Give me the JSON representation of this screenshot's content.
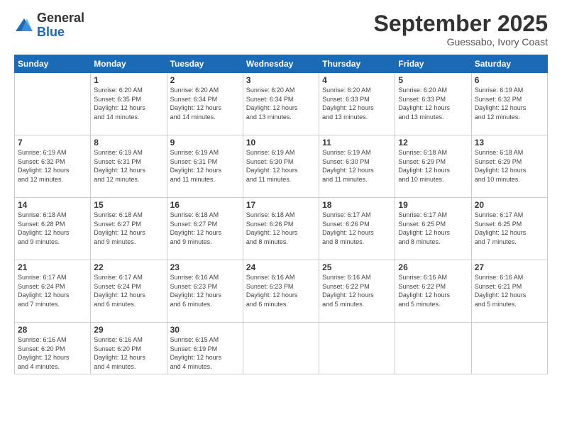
{
  "logo": {
    "general": "General",
    "blue": "Blue"
  },
  "header": {
    "month": "September 2025",
    "location": "Guessabo, Ivory Coast"
  },
  "weekdays": [
    "Sunday",
    "Monday",
    "Tuesday",
    "Wednesday",
    "Thursday",
    "Friday",
    "Saturday"
  ],
  "weeks": [
    [
      {
        "day": "",
        "info": ""
      },
      {
        "day": "1",
        "info": "Sunrise: 6:20 AM\nSunset: 6:35 PM\nDaylight: 12 hours\nand 14 minutes."
      },
      {
        "day": "2",
        "info": "Sunrise: 6:20 AM\nSunset: 6:34 PM\nDaylight: 12 hours\nand 14 minutes."
      },
      {
        "day": "3",
        "info": "Sunrise: 6:20 AM\nSunset: 6:34 PM\nDaylight: 12 hours\nand 13 minutes."
      },
      {
        "day": "4",
        "info": "Sunrise: 6:20 AM\nSunset: 6:33 PM\nDaylight: 12 hours\nand 13 minutes."
      },
      {
        "day": "5",
        "info": "Sunrise: 6:20 AM\nSunset: 6:33 PM\nDaylight: 12 hours\nand 13 minutes."
      },
      {
        "day": "6",
        "info": "Sunrise: 6:19 AM\nSunset: 6:32 PM\nDaylight: 12 hours\nand 12 minutes."
      }
    ],
    [
      {
        "day": "7",
        "info": "Sunrise: 6:19 AM\nSunset: 6:32 PM\nDaylight: 12 hours\nand 12 minutes."
      },
      {
        "day": "8",
        "info": "Sunrise: 6:19 AM\nSunset: 6:31 PM\nDaylight: 12 hours\nand 12 minutes."
      },
      {
        "day": "9",
        "info": "Sunrise: 6:19 AM\nSunset: 6:31 PM\nDaylight: 12 hours\nand 11 minutes."
      },
      {
        "day": "10",
        "info": "Sunrise: 6:19 AM\nSunset: 6:30 PM\nDaylight: 12 hours\nand 11 minutes."
      },
      {
        "day": "11",
        "info": "Sunrise: 6:19 AM\nSunset: 6:30 PM\nDaylight: 12 hours\nand 11 minutes."
      },
      {
        "day": "12",
        "info": "Sunrise: 6:18 AM\nSunset: 6:29 PM\nDaylight: 12 hours\nand 10 minutes."
      },
      {
        "day": "13",
        "info": "Sunrise: 6:18 AM\nSunset: 6:29 PM\nDaylight: 12 hours\nand 10 minutes."
      }
    ],
    [
      {
        "day": "14",
        "info": "Sunrise: 6:18 AM\nSunset: 6:28 PM\nDaylight: 12 hours\nand 9 minutes."
      },
      {
        "day": "15",
        "info": "Sunrise: 6:18 AM\nSunset: 6:27 PM\nDaylight: 12 hours\nand 9 minutes."
      },
      {
        "day": "16",
        "info": "Sunrise: 6:18 AM\nSunset: 6:27 PM\nDaylight: 12 hours\nand 9 minutes."
      },
      {
        "day": "17",
        "info": "Sunrise: 6:18 AM\nSunset: 6:26 PM\nDaylight: 12 hours\nand 8 minutes."
      },
      {
        "day": "18",
        "info": "Sunrise: 6:17 AM\nSunset: 6:26 PM\nDaylight: 12 hours\nand 8 minutes."
      },
      {
        "day": "19",
        "info": "Sunrise: 6:17 AM\nSunset: 6:25 PM\nDaylight: 12 hours\nand 8 minutes."
      },
      {
        "day": "20",
        "info": "Sunrise: 6:17 AM\nSunset: 6:25 PM\nDaylight: 12 hours\nand 7 minutes."
      }
    ],
    [
      {
        "day": "21",
        "info": "Sunrise: 6:17 AM\nSunset: 6:24 PM\nDaylight: 12 hours\nand 7 minutes."
      },
      {
        "day": "22",
        "info": "Sunrise: 6:17 AM\nSunset: 6:24 PM\nDaylight: 12 hours\nand 6 minutes."
      },
      {
        "day": "23",
        "info": "Sunrise: 6:16 AM\nSunset: 6:23 PM\nDaylight: 12 hours\nand 6 minutes."
      },
      {
        "day": "24",
        "info": "Sunrise: 6:16 AM\nSunset: 6:23 PM\nDaylight: 12 hours\nand 6 minutes."
      },
      {
        "day": "25",
        "info": "Sunrise: 6:16 AM\nSunset: 6:22 PM\nDaylight: 12 hours\nand 5 minutes."
      },
      {
        "day": "26",
        "info": "Sunrise: 6:16 AM\nSunset: 6:22 PM\nDaylight: 12 hours\nand 5 minutes."
      },
      {
        "day": "27",
        "info": "Sunrise: 6:16 AM\nSunset: 6:21 PM\nDaylight: 12 hours\nand 5 minutes."
      }
    ],
    [
      {
        "day": "28",
        "info": "Sunrise: 6:16 AM\nSunset: 6:20 PM\nDaylight: 12 hours\nand 4 minutes."
      },
      {
        "day": "29",
        "info": "Sunrise: 6:16 AM\nSunset: 6:20 PM\nDaylight: 12 hours\nand 4 minutes."
      },
      {
        "day": "30",
        "info": "Sunrise: 6:15 AM\nSunset: 6:19 PM\nDaylight: 12 hours\nand 4 minutes."
      },
      {
        "day": "",
        "info": ""
      },
      {
        "day": "",
        "info": ""
      },
      {
        "day": "",
        "info": ""
      },
      {
        "day": "",
        "info": ""
      }
    ]
  ]
}
